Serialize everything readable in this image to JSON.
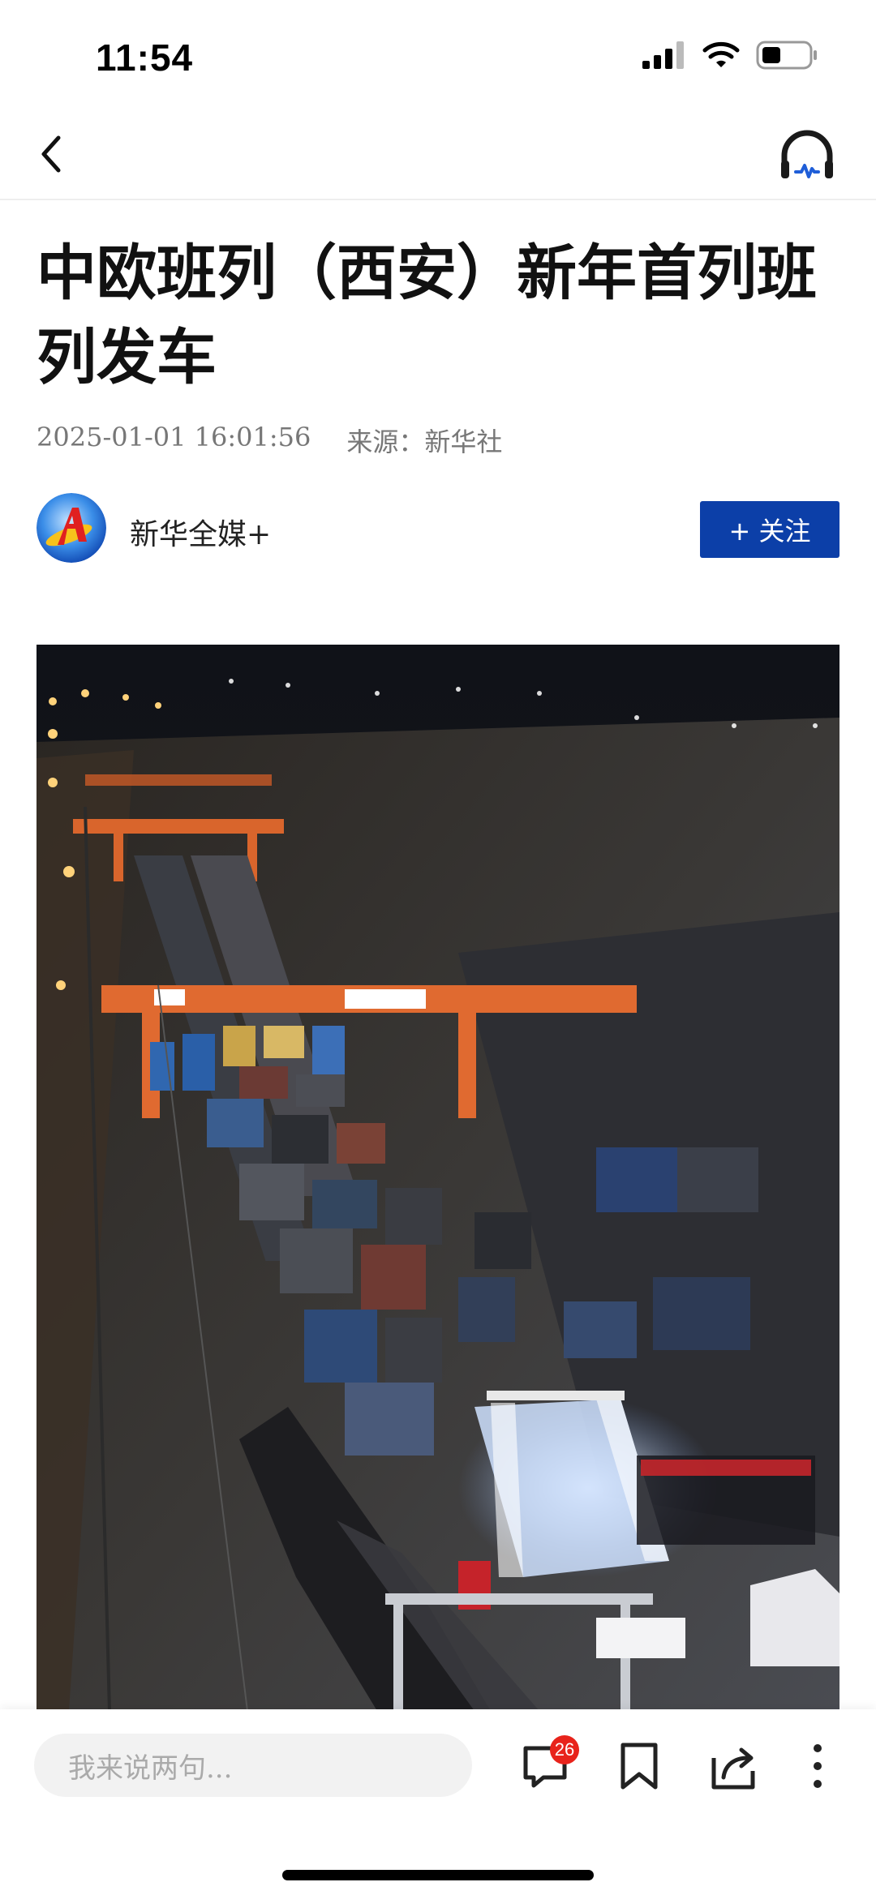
{
  "status_bar": {
    "time": "11:54"
  },
  "article": {
    "title": "中欧班列（西安）新年首列班列发车",
    "datetime": "2025-01-01 16:01:56",
    "source": "来源：新华社"
  },
  "author": {
    "name": "新华全媒+",
    "follow_label": "+ 关注"
  },
  "bottom_bar": {
    "comment_placeholder": "我来说两句...",
    "comment_count": "26"
  },
  "colors": {
    "follow_button": "#0c3fa8",
    "badge": "#e8231b"
  }
}
